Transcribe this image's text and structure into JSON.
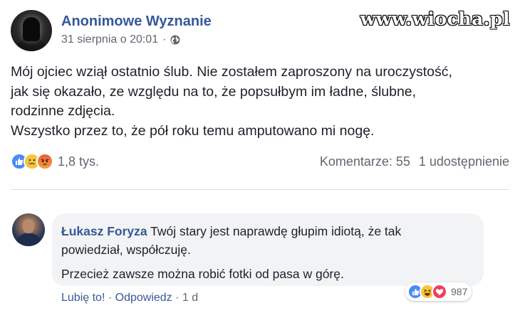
{
  "post": {
    "page_name": "Anonimowe Wyznanie",
    "timestamp": "31 sierpnia o 20:01",
    "separator": "·",
    "privacy_icon": "globe-icon",
    "lines": [
      "Mój ojciec wziął ostatnio ślub. Nie zostałem zaproszony na uroczystość,",
      "jak się okazało, ze względu na to, że popsułbym im ładne, ślubne,",
      "rodzinne zdjęcia.",
      "Wszystko przez to, że pół roku temu amputowano mi nogę."
    ]
  },
  "watermark": "www.wiocha.pl",
  "reactions": {
    "icons": [
      "like-icon",
      "sad-icon",
      "angry-icon"
    ],
    "count": "1,8 tys.",
    "comments": "Komentarze: 55",
    "shares": "1 udostępnienie"
  },
  "comment": {
    "author": "Łukasz Foryza",
    "text_line1": "Twój stary jest naprawdę głupim idiotą, że tak",
    "text_line2": "powiedział, współczuję.",
    "text_line3": "Przecież zawsze można robić fotki od pasa w górę.",
    "reaction_icons": [
      "like-icon",
      "haha-icon",
      "love-icon"
    ],
    "reaction_count": "987",
    "like_label": "Lubię to!",
    "reply_label": "Odpowiedz",
    "age": "1 d",
    "separator": "·"
  },
  "colors": {
    "link_blue": "#365899",
    "meta_gray": "#616770",
    "bubble_bg": "#f2f3f5",
    "like_blue": "#4b8bf5",
    "love_red": "#f0405a"
  }
}
